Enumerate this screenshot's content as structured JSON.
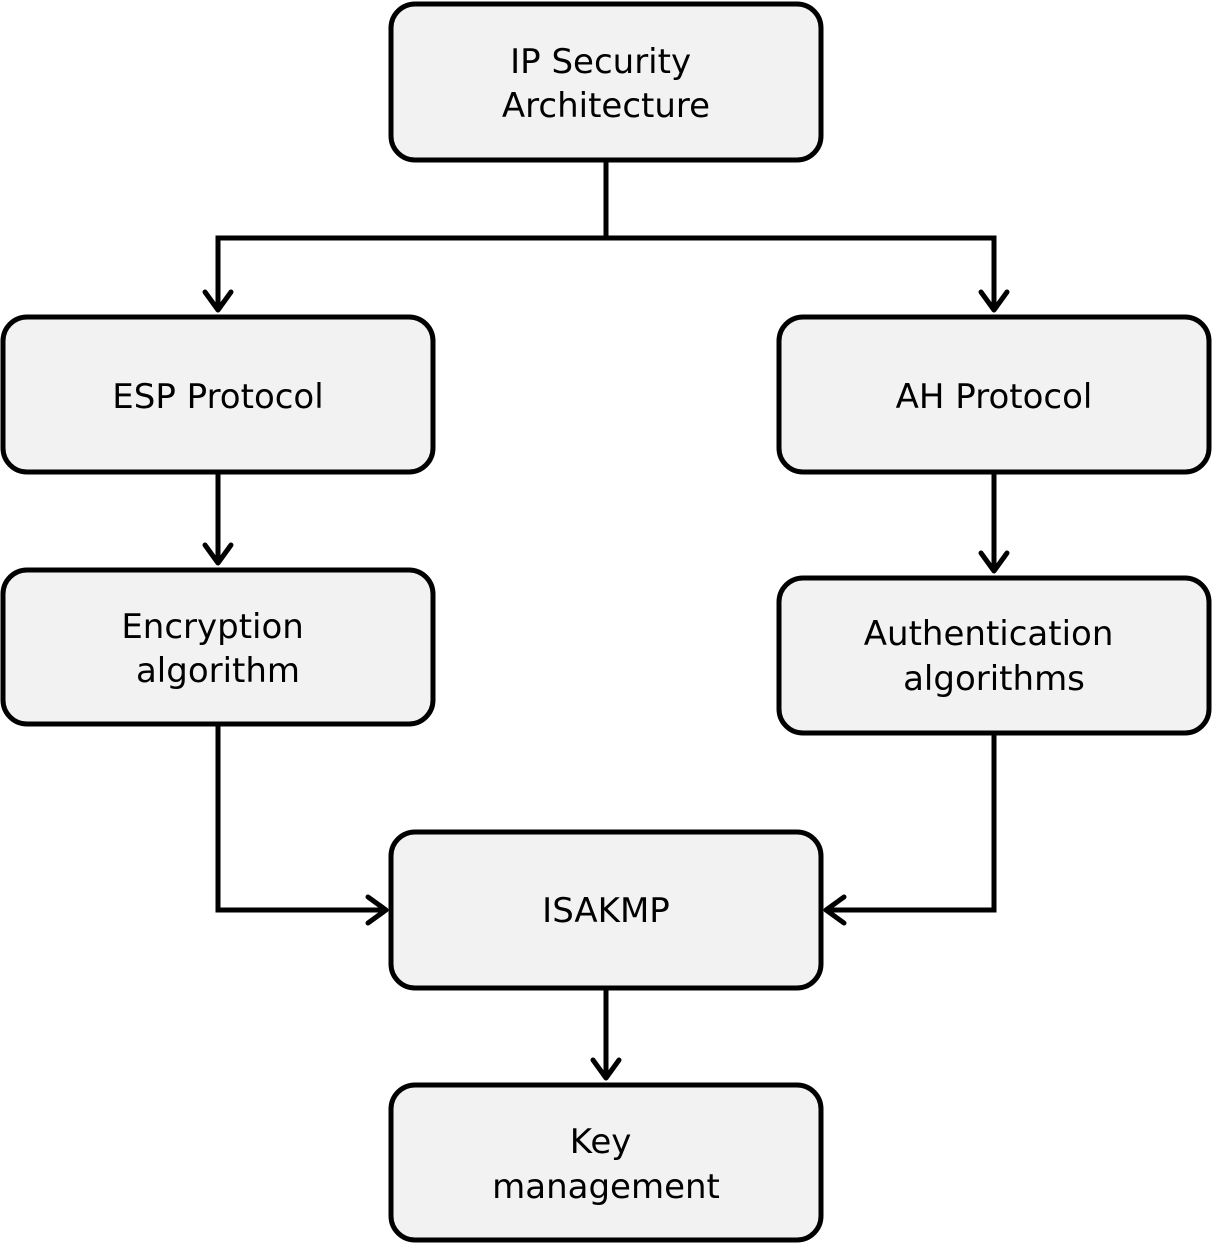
{
  "colors": {
    "node_fill": "#f2f2f2",
    "stroke": "#000000",
    "background": "#ffffff"
  },
  "nodes": {
    "ipsec": {
      "lines": [
        "IP Security",
        "Architecture"
      ]
    },
    "esp": {
      "lines": [
        "ESP Protocol"
      ]
    },
    "ah": {
      "lines": [
        "AH Protocol"
      ]
    },
    "encryption": {
      "lines": [
        "Encryption",
        "algorithm"
      ]
    },
    "authentication": {
      "lines": [
        "Authentication",
        "algorithms"
      ]
    },
    "isakmp": {
      "lines": [
        "ISAKMP"
      ]
    },
    "key": {
      "lines": [
        "Key",
        "management"
      ]
    }
  },
  "edges": [
    {
      "from": "ipsec",
      "to": "esp"
    },
    {
      "from": "ipsec",
      "to": "ah"
    },
    {
      "from": "esp",
      "to": "encryption"
    },
    {
      "from": "ah",
      "to": "authentication"
    },
    {
      "from": "encryption",
      "to": "isakmp"
    },
    {
      "from": "authentication",
      "to": "isakmp"
    },
    {
      "from": "isakmp",
      "to": "key"
    }
  ]
}
